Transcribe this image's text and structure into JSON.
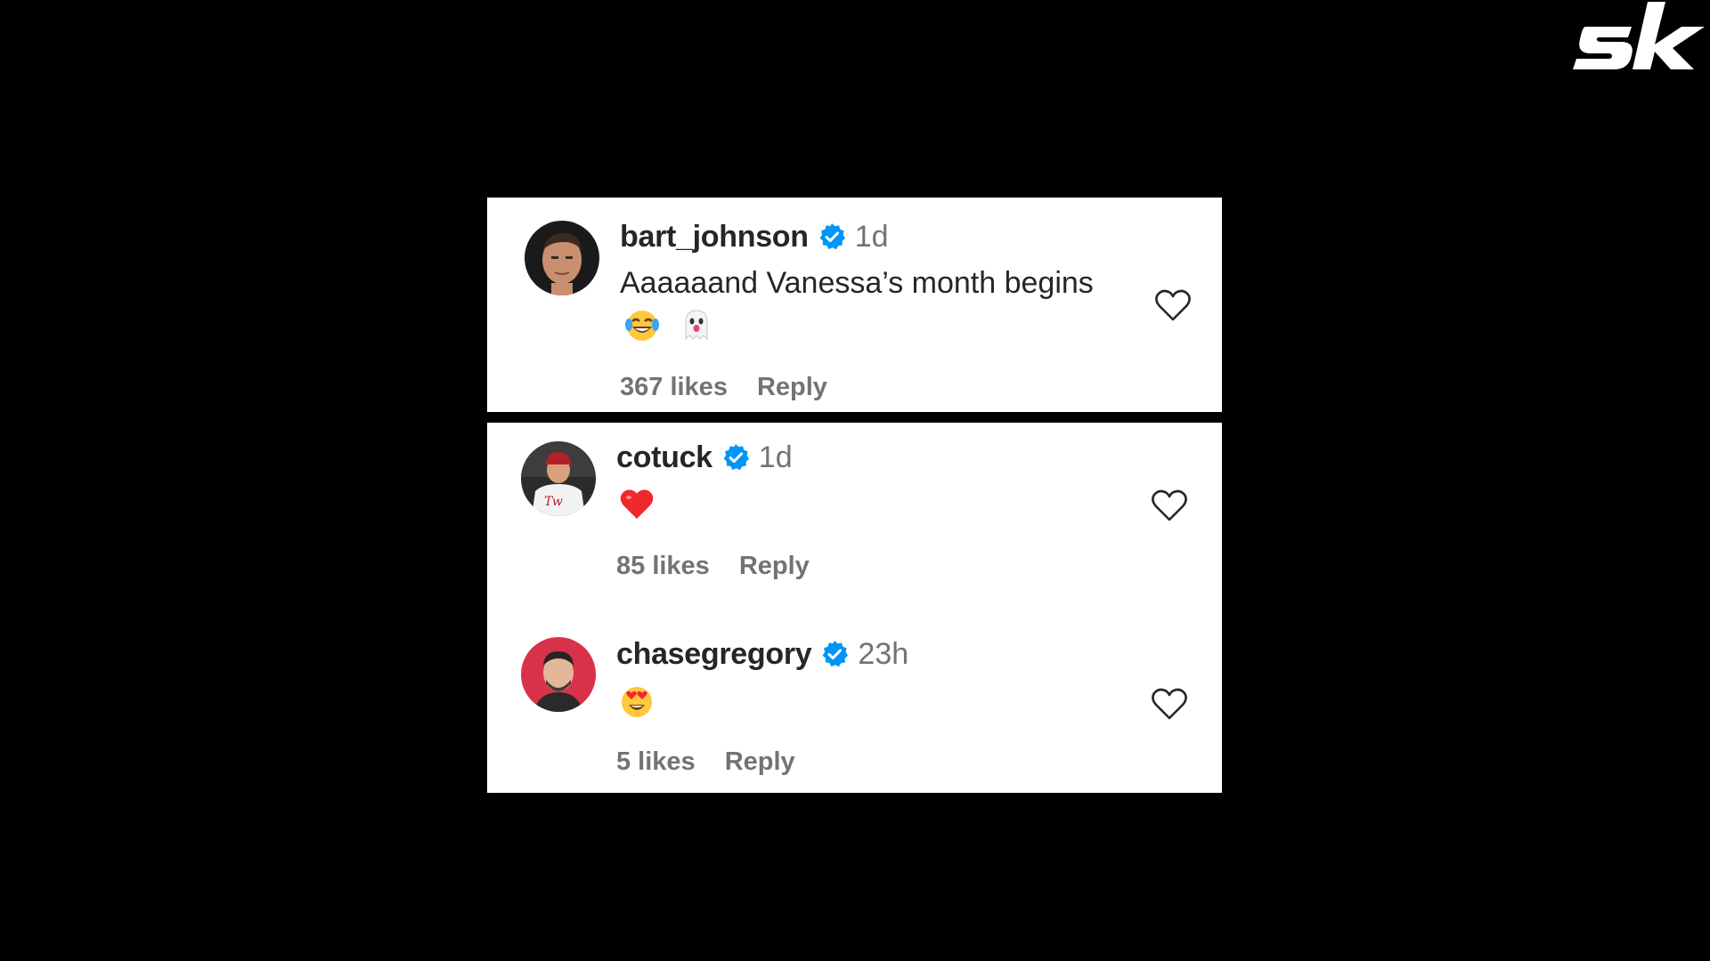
{
  "brand": {
    "logo_icon": "sk-logo",
    "logo_color": "#ffffff"
  },
  "comments": [
    {
      "username": "bart_johnson",
      "verified": true,
      "time": "1d",
      "text": "Aaaaaand Vanessa’s month begins",
      "emojis": [
        "face-with-tears-of-joy-emoji",
        "ghost-emoji"
      ],
      "likes": "367 likes",
      "reply": "Reply"
    },
    {
      "username": "cotuck",
      "verified": true,
      "time": "1d",
      "text": "",
      "emojis": [
        "red-heart-emoji"
      ],
      "likes": "85 likes",
      "reply": "Reply"
    },
    {
      "username": "chasegregory",
      "verified": true,
      "time": "23h",
      "text": "",
      "emojis": [
        "smiling-face-with-heart-eyes-emoji"
      ],
      "likes": "5 likes",
      "reply": "Reply"
    }
  ],
  "colors": {
    "background": "#000000",
    "card": "#ffffff",
    "text_primary": "#262626",
    "text_secondary": "#737373",
    "verified_badge": "#0095f6"
  }
}
